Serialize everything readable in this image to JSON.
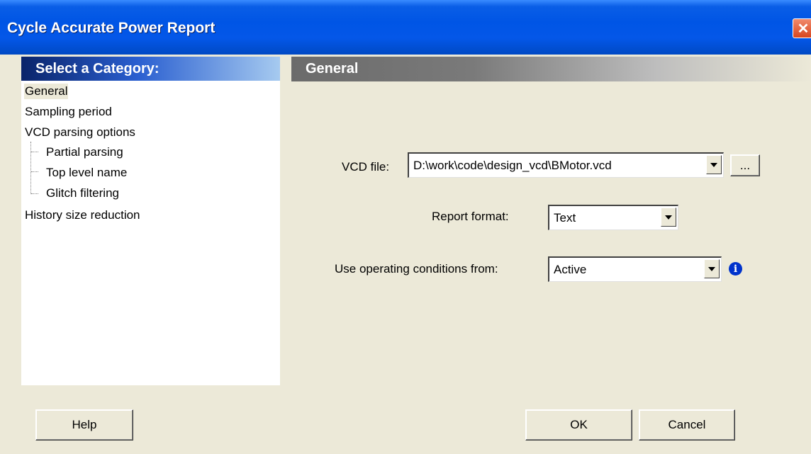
{
  "window": {
    "title": "Cycle Accurate Power Report",
    "close_glyph": "✕"
  },
  "category_panel": {
    "header": "Select a Category:",
    "items": [
      {
        "label": "General",
        "selected": true
      },
      {
        "label": "Sampling period"
      },
      {
        "label": "VCD parsing options"
      },
      {
        "label": "Partial parsing"
      },
      {
        "label": "Top level name"
      },
      {
        "label": "Glitch filtering"
      },
      {
        "label": "History size reduction"
      }
    ]
  },
  "section": {
    "title": "General"
  },
  "form": {
    "vcd_file": {
      "label": "VCD file:",
      "value": "D:\\work\\code\\design_vcd\\BMotor.vcd",
      "browse_label": "..."
    },
    "report_format": {
      "label": "Report format:",
      "value": "Text"
    },
    "operating_conditions": {
      "label": "Use operating conditions from:",
      "value": "Active",
      "info_glyph": "i"
    }
  },
  "buttons": {
    "help": "Help",
    "ok": "OK",
    "cancel": "Cancel"
  },
  "colors": {
    "titlebar": "#0055e5",
    "dialog_bg": "#ece9d8",
    "info_icon": "#0033cc"
  }
}
